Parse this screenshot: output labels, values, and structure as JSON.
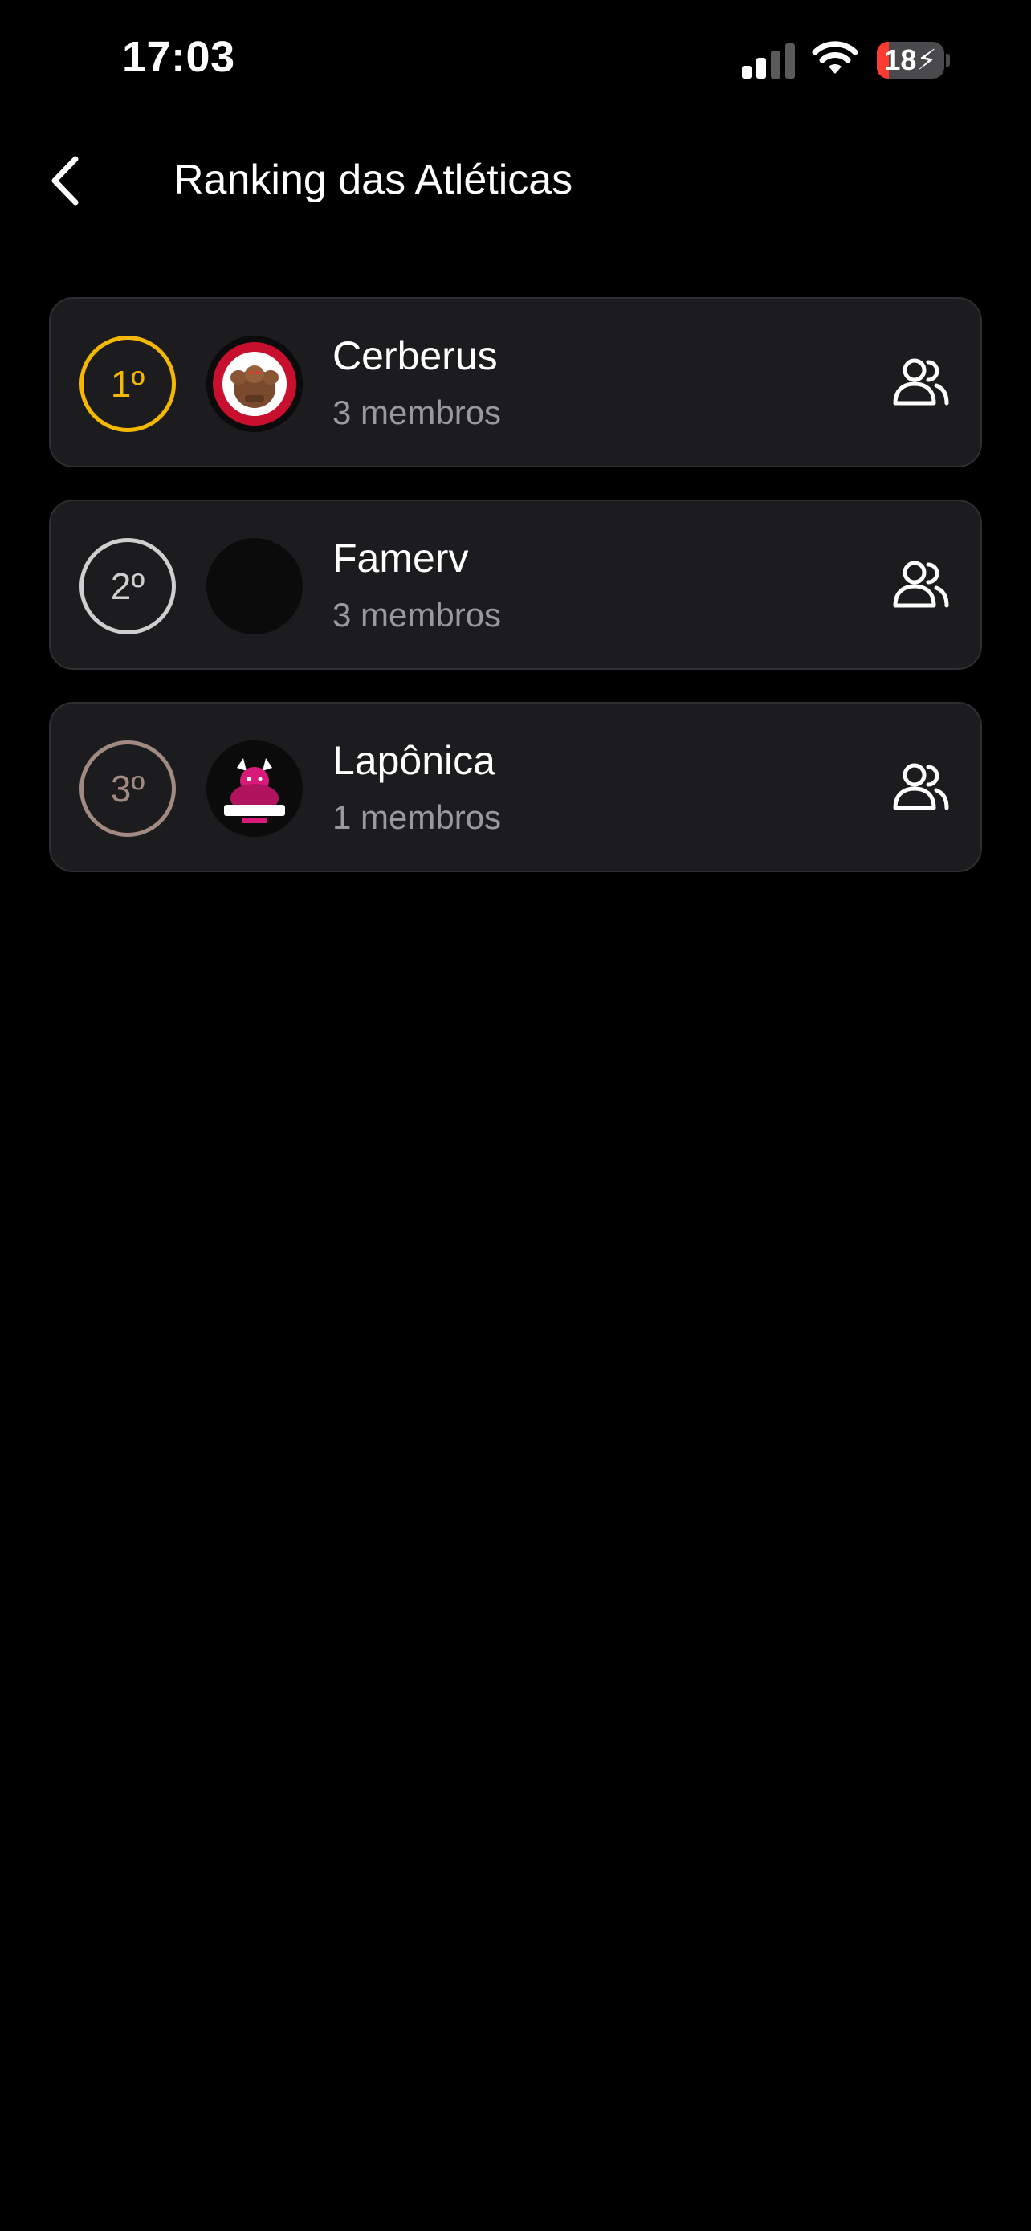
{
  "status_bar": {
    "time": "17:03",
    "battery_level": "18",
    "battery_fraction": 0.18,
    "battery_color": "#ff3b30",
    "icons": [
      "cellular-signal-icon",
      "wifi-icon",
      "battery-charging-icon"
    ]
  },
  "header": {
    "back_icon": "chevron-left-icon",
    "title": "Ranking das Atléticas"
  },
  "ranking": [
    {
      "position": "1º",
      "badge_color": "#f5b800",
      "name": "Cerberus",
      "members": "3 membros",
      "logo": "cerberus-logo",
      "action_icon": "members-icon"
    },
    {
      "position": "2º",
      "badge_color": "#cfcfcf",
      "name": "Famerv",
      "members": "3 membros",
      "logo": "empty-logo",
      "action_icon": "members-icon"
    },
    {
      "position": "3º",
      "badge_color": "#a08a82",
      "name": "Lapônica",
      "members": "1 membros",
      "logo": "laponica-logo",
      "action_icon": "members-icon"
    }
  ],
  "colors": {
    "background": "#000000",
    "card_background": "#1c1c1e",
    "card_border": "#2f2f31",
    "secondary_text": "#9a9a9e"
  }
}
